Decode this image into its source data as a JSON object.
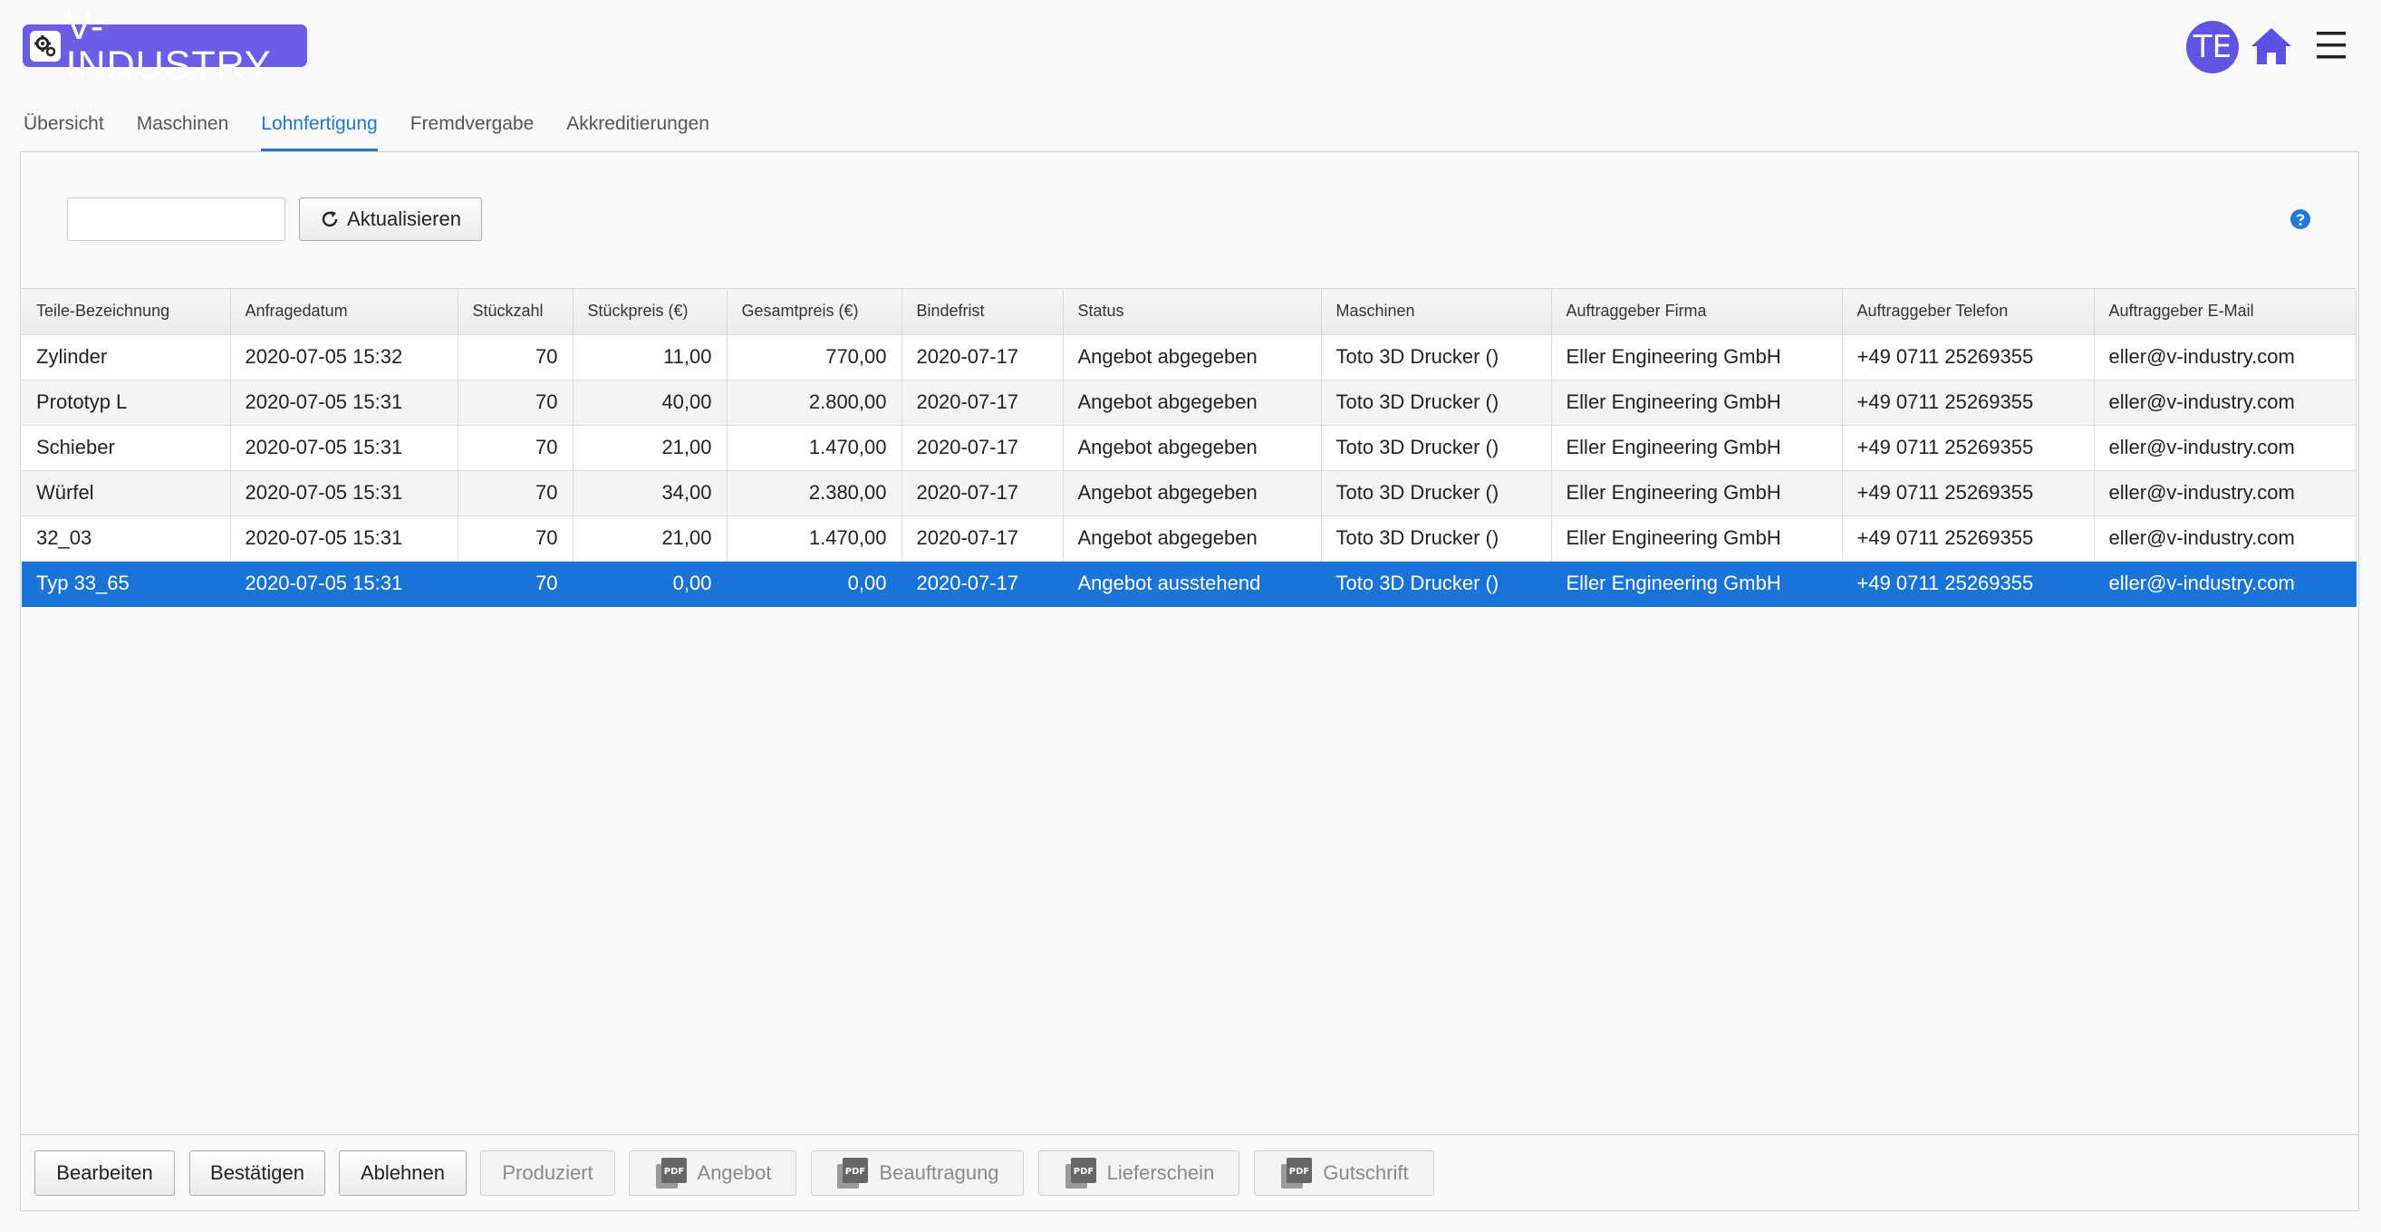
{
  "app": {
    "logo_text": "V-INDUSTRY",
    "logo_icon": "gear-icon",
    "avatar_initials": "TE",
    "brand_color": "#6a5de6",
    "accent_color": "#2278cc",
    "selected_row_color": "#1a73d6"
  },
  "tabs": [
    {
      "label": "Übersicht",
      "active": false
    },
    {
      "label": "Maschinen",
      "active": false
    },
    {
      "label": "Lohnfertigung",
      "active": true
    },
    {
      "label": "Fremdvergabe",
      "active": false
    },
    {
      "label": "Akkreditierungen",
      "active": false
    }
  ],
  "filter": {
    "search_value": "",
    "refresh_label": "Aktualisieren"
  },
  "table": {
    "columns": [
      "Teile-Bezeichnung",
      "Anfragedatum",
      "Stückzahl",
      "Stückpreis (€)",
      "Gesamtpreis (€)",
      "Bindefrist",
      "Status",
      "Maschinen",
      "Auftraggeber Firma",
      "Auftraggeber Telefon",
      "Auftraggeber E-Mail"
    ],
    "rows": [
      [
        "Zylinder",
        "2020-07-05 15:32",
        "70",
        "11,00",
        "770,00",
        "2020-07-17",
        "Angebot abgegeben",
        "Toto 3D Drucker ()",
        "Eller Engineering GmbH",
        "+49 0711 25269355",
        "eller@v-industry.com"
      ],
      [
        "Prototyp L",
        "2020-07-05 15:31",
        "70",
        "40,00",
        "2.800,00",
        "2020-07-17",
        "Angebot abgegeben",
        "Toto 3D Drucker ()",
        "Eller Engineering GmbH",
        "+49 0711 25269355",
        "eller@v-industry.com"
      ],
      [
        "Schieber",
        "2020-07-05 15:31",
        "70",
        "21,00",
        "1.470,00",
        "2020-07-17",
        "Angebot abgegeben",
        "Toto 3D Drucker ()",
        "Eller Engineering GmbH",
        "+49 0711 25269355",
        "eller@v-industry.com"
      ],
      [
        "Würfel",
        "2020-07-05 15:31",
        "70",
        "34,00",
        "2.380,00",
        "2020-07-17",
        "Angebot abgegeben",
        "Toto 3D Drucker ()",
        "Eller Engineering GmbH",
        "+49 0711 25269355",
        "eller@v-industry.com"
      ],
      [
        "32_03",
        "2020-07-05 15:31",
        "70",
        "21,00",
        "1.470,00",
        "2020-07-17",
        "Angebot abgegeben",
        "Toto 3D Drucker ()",
        "Eller Engineering GmbH",
        "+49 0711 25269355",
        "eller@v-industry.com"
      ],
      [
        "Typ 33_65",
        "2020-07-05 15:31",
        "70",
        "0,00",
        "0,00",
        "2020-07-17",
        "Angebot ausstehend",
        "Toto 3D Drucker ()",
        "Eller Engineering GmbH",
        "+49 0711 25269355",
        "eller@v-industry.com"
      ]
    ],
    "selected_row": 5
  },
  "toolbar": {
    "edit_label": "Bearbeiten",
    "confirm_label": "Bestätigen",
    "reject_label": "Ablehnen",
    "produced_label": "Produziert",
    "offer_label": "Angebot",
    "commission_label": "Beauftragung",
    "delivery_label": "Lieferschein",
    "credit_label": "Gutschrift",
    "pdf_icon_text": "PDF"
  }
}
